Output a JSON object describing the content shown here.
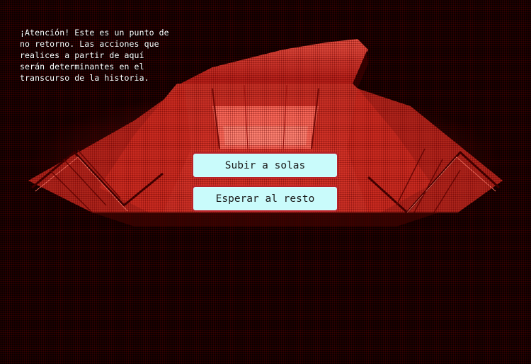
{
  "warning": {
    "text": "¡Atención! Este es un punto de no retorno. Las acciones que realices a partir de aquí serán determinantes en el transcurso de la historia."
  },
  "choices": [
    {
      "label": "Subir a solas"
    },
    {
      "label": "Esperar al resto"
    }
  ],
  "colors": {
    "background": "#0b0000",
    "scene_red": "#ff4a3c",
    "button_fill": "#c9fbfb",
    "button_border": "#b8232a",
    "text": "#ffffff"
  }
}
